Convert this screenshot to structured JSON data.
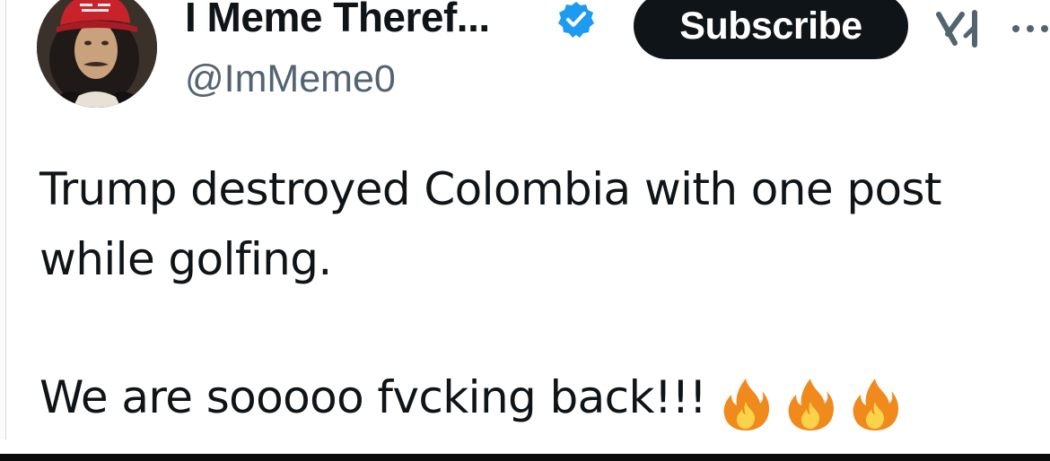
{
  "tweet": {
    "author": {
      "display_name": "I Meme Theref...",
      "handle": "@ImMeme0",
      "verified": true,
      "avatar_icon": "portrait-with-red-cap-avatar"
    },
    "subscribe_label": "Subscribe",
    "body": {
      "line1": "Trump destroyed Colombia with one post",
      "line2": "while golfing.",
      "line3": "We are sooooo fvcking back!!!",
      "emoji": [
        "🔥",
        "🔥",
        "🔥"
      ]
    }
  },
  "icons": {
    "verified": "verified-badge-icon",
    "grok": "grok-icon",
    "more": "more-options-icon",
    "fire": "fire-emoji-icon"
  },
  "colors": {
    "text_primary": "#0f1419",
    "text_secondary": "#536471",
    "verified_blue": "#1d9bf0",
    "button_bg": "#0f1419",
    "button_text": "#ffffff"
  }
}
